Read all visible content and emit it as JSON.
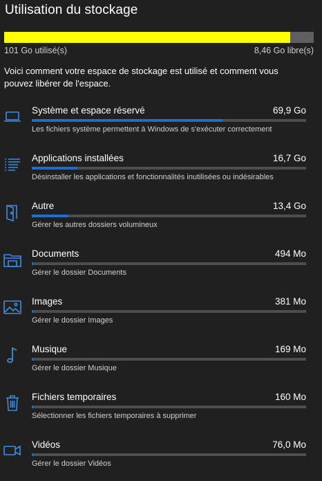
{
  "page": {
    "title": "Utilisation du stockage"
  },
  "summary": {
    "used_label": "101 Go utilisé(s)",
    "free_label": "8,46 Go libre(s)",
    "used_fraction": 0.923,
    "used_color": "#ffff00",
    "track_color": "#5f5f5f"
  },
  "intro": "Voici comment votre espace de stockage est utilisé et comment vous pouvez libérer de l'espace.",
  "theme": {
    "accent": "#1a6fd0",
    "icon_color": "#3a8ee6",
    "background": "#202020"
  },
  "categories": [
    {
      "icon": "laptop-icon",
      "name": "Système et espace réservé",
      "size": "69,9 Go",
      "description": "Les fichiers système permettent à Windows de s'exécuter correctement",
      "fill_fraction": 0.694
    },
    {
      "icon": "apps-list-icon",
      "name": "Applications installées",
      "size": "16,7 Go",
      "description": "Désinstaller les applications et fonctionnalités inutilisées ou indésirables",
      "fill_fraction": 0.166
    },
    {
      "icon": "door-icon",
      "name": "Autre",
      "size": "13,4 Go",
      "description": "Gérer les autres dossiers volumineux",
      "fill_fraction": 0.133
    },
    {
      "icon": "folder-icon",
      "name": "Documents",
      "size": "494 Mo",
      "description": "Gérer le dossier Documents",
      "fill_fraction": 0.005
    },
    {
      "icon": "image-icon",
      "name": "Images",
      "size": "381 Mo",
      "description": "Gérer le dossier Images",
      "fill_fraction": 0.004
    },
    {
      "icon": "music-note-icon",
      "name": "Musique",
      "size": "169 Mo",
      "description": "Gérer le dossier Musique",
      "fill_fraction": 0.002
    },
    {
      "icon": "trash-icon",
      "name": "Fichiers temporaires",
      "size": "160 Mo",
      "description": "Sélectionner les fichiers temporaires à supprimer",
      "fill_fraction": 0.002
    },
    {
      "icon": "video-camera-icon",
      "name": "Vidéos",
      "size": "76,0 Mo",
      "description": "Gérer le dossier Vidéos",
      "fill_fraction": 0.001
    }
  ]
}
